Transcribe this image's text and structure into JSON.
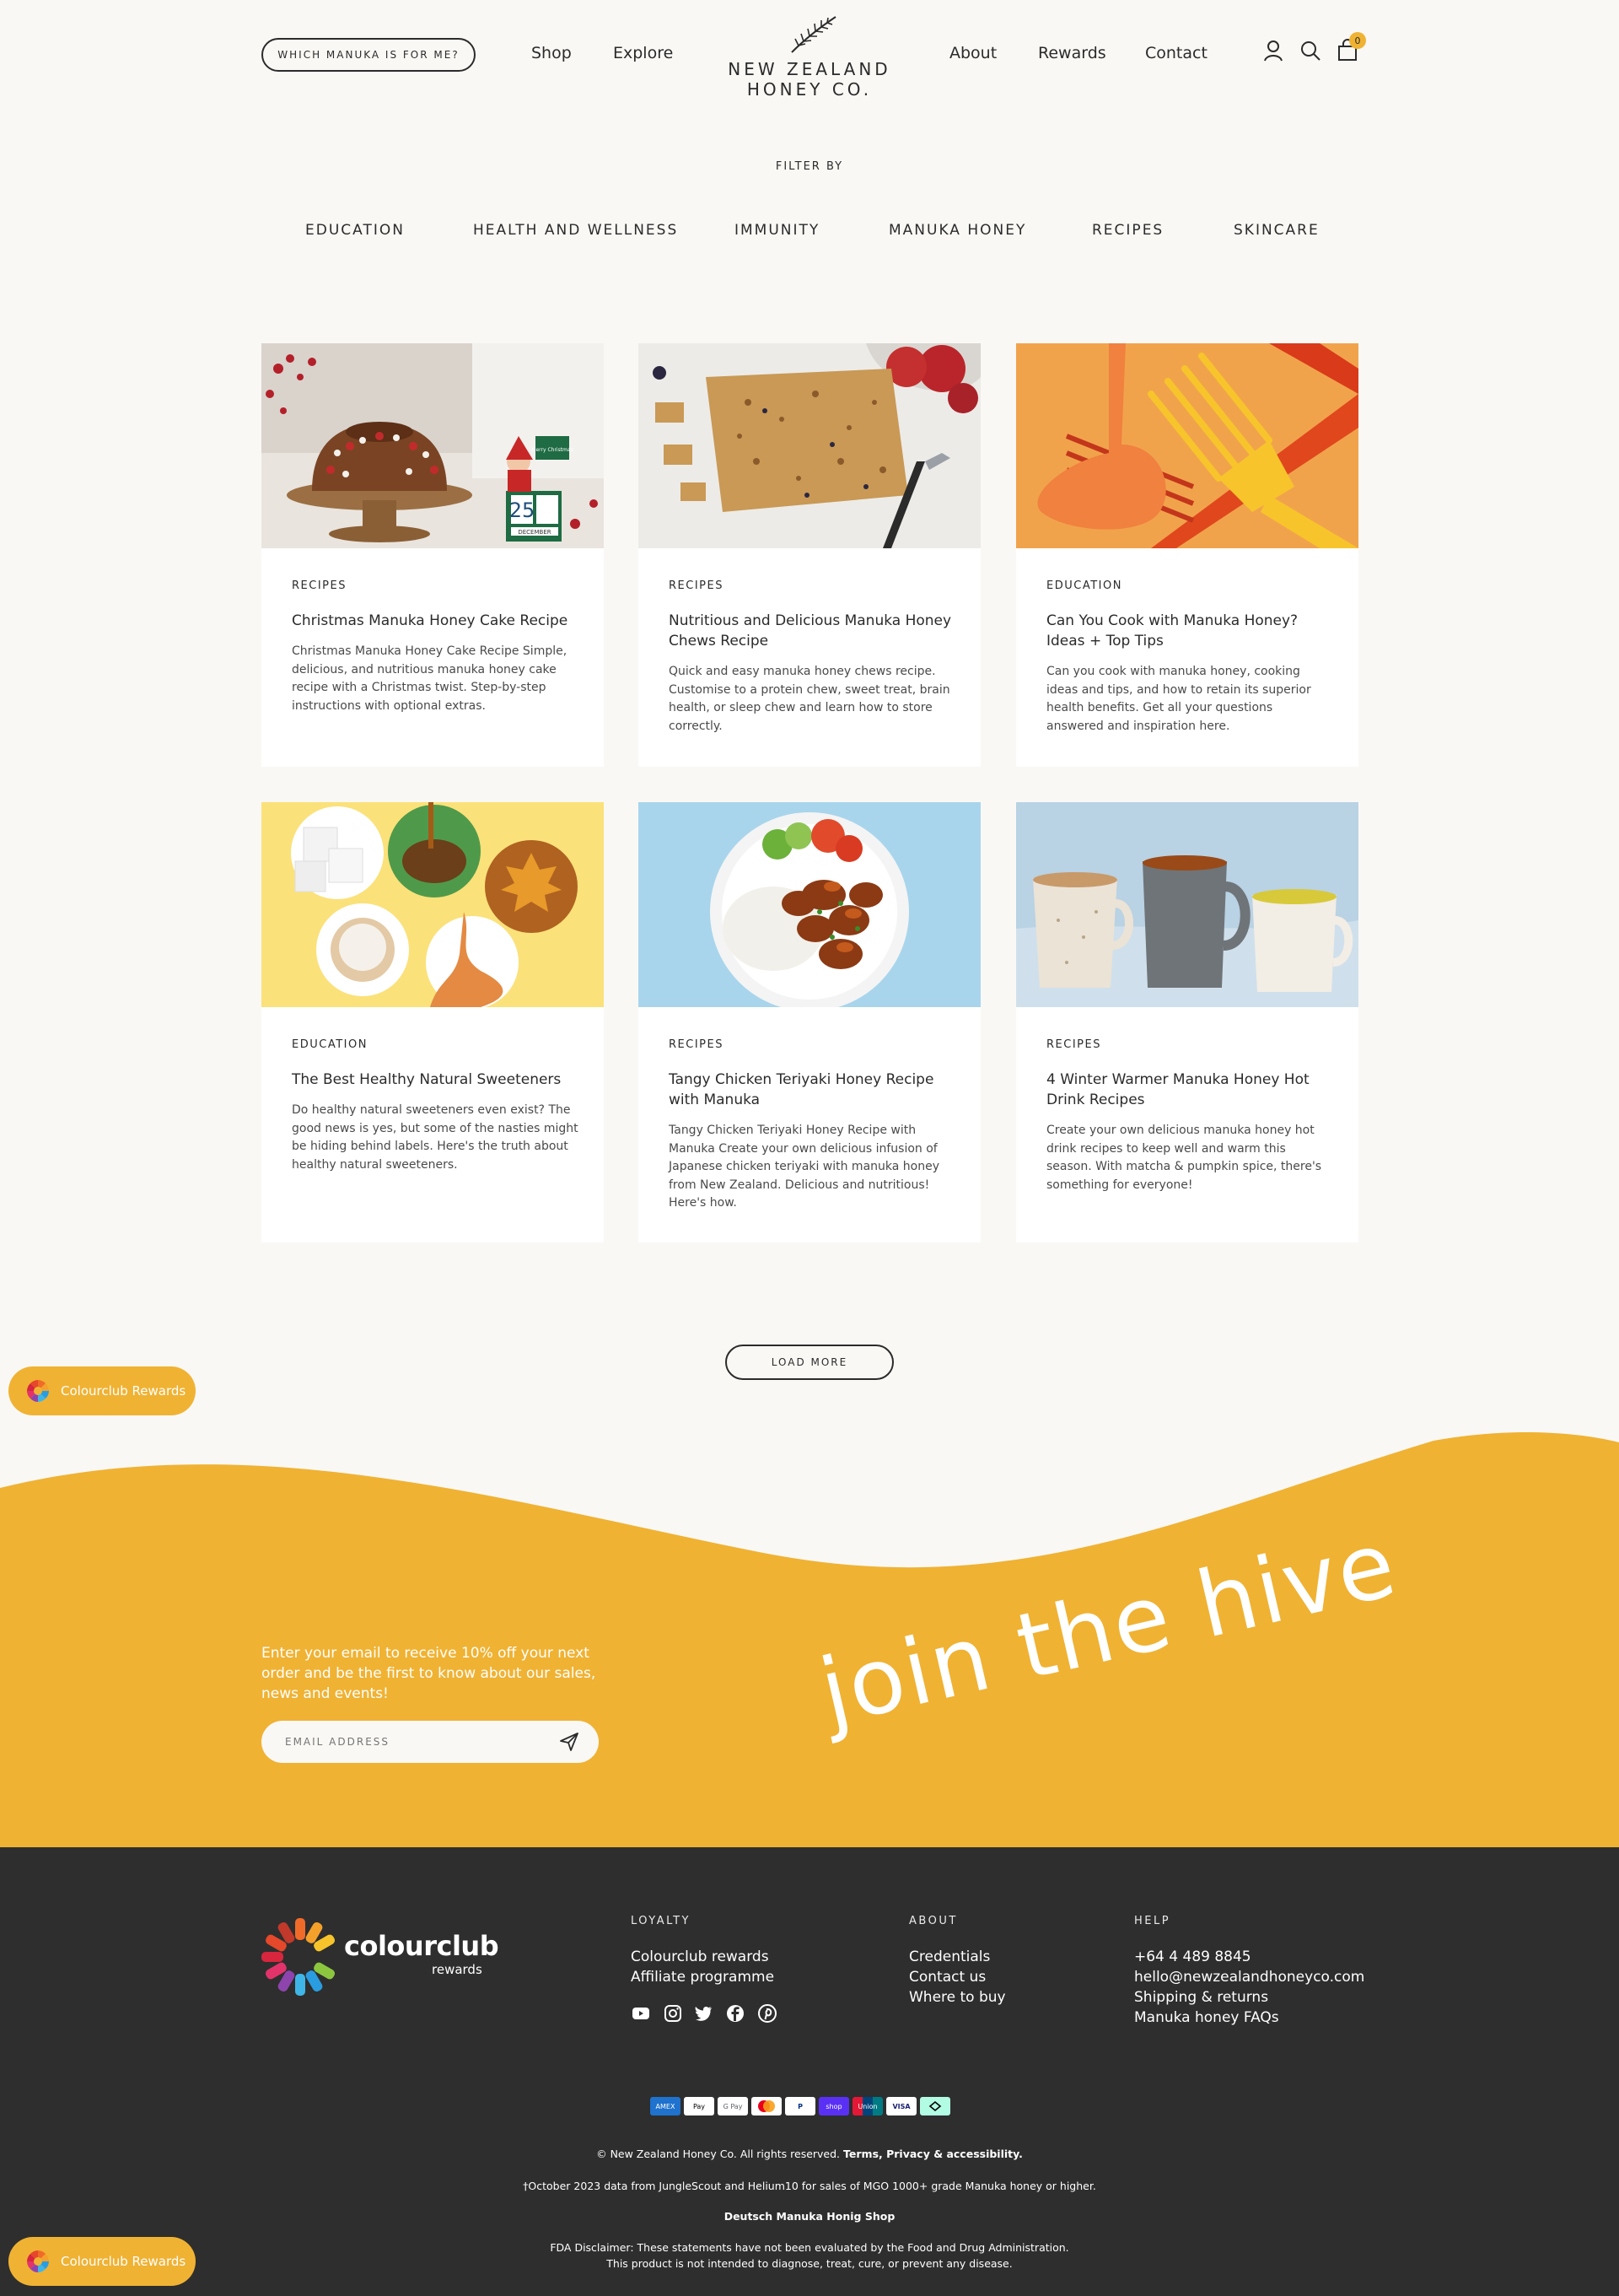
{
  "header": {
    "cta_label": "WHICH MANUKA IS FOR ME?",
    "nav_left": [
      "Shop",
      "Explore"
    ],
    "logo_line1": "NEW ZEALAND",
    "logo_line2": "HONEY CO.",
    "nav_right": [
      "About",
      "Rewards",
      "Contact"
    ],
    "icons": [
      "account-icon",
      "search-icon",
      "cart-icon"
    ],
    "cart_count": "0"
  },
  "filter": {
    "label": "FILTER BY",
    "items": [
      "EDUCATION",
      "HEALTH AND WELLNESS",
      "IMMUNITY",
      "MANUKA HONEY",
      "RECIPES",
      "SKINCARE"
    ]
  },
  "articles": [
    {
      "category": "RECIPES",
      "title": "Christmas Manuka Honey Cake Recipe",
      "description": "Christmas Manuka Honey Cake Recipe Simple, delicious, and nutritious manuka honey cake recipe with a Christmas twist. Step-by-step instructions with optional extras.",
      "calendar_day": "25",
      "calendar_month": "DECEMBER",
      "sign": "Merry Christmas"
    },
    {
      "category": "RECIPES",
      "title": "Nutritious and Delicious Manuka Honey Chews Recipe",
      "description": "Quick and easy manuka honey chews recipe. Customise to a protein chew, sweet treat, brain health, or sleep chew and learn how to store correctly."
    },
    {
      "category": "EDUCATION",
      "title": "Can You Cook with Manuka Honey? Ideas + Top Tips",
      "description": "Can you cook with manuka honey, cooking ideas and tips, and how to retain its superior health benefits. Get all your questions answered and inspiration here."
    },
    {
      "category": "EDUCATION",
      "title": "The Best Healthy Natural Sweeteners",
      "description": "Do healthy natural sweeteners even exist? The good news is yes, but some of the nasties might be hiding behind labels. Here's the truth about healthy natural sweeteners."
    },
    {
      "category": "RECIPES",
      "title": "Tangy Chicken Teriyaki Honey Recipe with Manuka",
      "description": "Tangy Chicken Teriyaki Honey Recipe with Manuka Create your own delicious infusion of Japanese chicken teriyaki with manuka honey from New Zealand. Delicious and nutritious! Here's how."
    },
    {
      "category": "RECIPES",
      "title": "4 Winter Warmer Manuka Honey Hot Drink Recipes",
      "description": "Create your own delicious manuka honey hot drink recipes to keep well and warm this season. With matcha & pumpkin spice, there's something for everyone!"
    }
  ],
  "load_more": "LOAD MORE",
  "rewards_widget": "Colourclub Rewards",
  "newsletter": {
    "copy": "Enter your email to receive 10% off your next order and be the first to know about our sales, news and events!",
    "placeholder": "EMAIL ADDRESS",
    "headline": "join the hive"
  },
  "footer": {
    "brand": "colourclub",
    "brand_sub": "rewards",
    "loyalty": {
      "heading": "LOYALTY",
      "links": [
        "Colourclub rewards",
        "Affiliate programme"
      ]
    },
    "about": {
      "heading": "ABOUT",
      "links": [
        "Credentials",
        "Contact us",
        "Where to buy"
      ]
    },
    "help": {
      "heading": "HELP",
      "links": [
        "+64 4 489 8845",
        "hello@newzealandhoneyco.com",
        "Shipping & returns",
        "Manuka honey FAQs"
      ]
    },
    "social": [
      "youtube-icon",
      "instagram-icon",
      "twitter-icon",
      "facebook-icon",
      "pinterest-icon"
    ],
    "payments": [
      {
        "label": "AMEX",
        "color": "#1f72cd"
      },
      {
        "label": "Pay",
        "color": "#ffffff"
      },
      {
        "label": "G Pay",
        "color": "#ffffff"
      },
      {
        "label": "",
        "color": "#ffffff"
      },
      {
        "label": "P",
        "color": "#ffffff"
      },
      {
        "label": "shop",
        "color": "#5a31f4"
      },
      {
        "label": "Union",
        "color": "#0e8fbd"
      },
      {
        "label": "VISA",
        "color": "#ffffff"
      },
      {
        "label": "",
        "color": "#b2fce4"
      }
    ],
    "copyright_prefix": "© New Zealand Honey Co. All rights reserved.",
    "copyright_links": "Terms, Privacy & accessibility.",
    "data_note": "†October 2023 data from JungleScout and Helium10 for sales of MGO 1000+ grade Manuka honey or higher.",
    "deutsch": "Deutsch Manuka Honig Shop",
    "fda1": "FDA Disclaimer: These statements have not been evaluated by the Food and Drug Administration.",
    "fda2": "This product is not intended to diagnose, treat, cure, or prevent any disease."
  }
}
